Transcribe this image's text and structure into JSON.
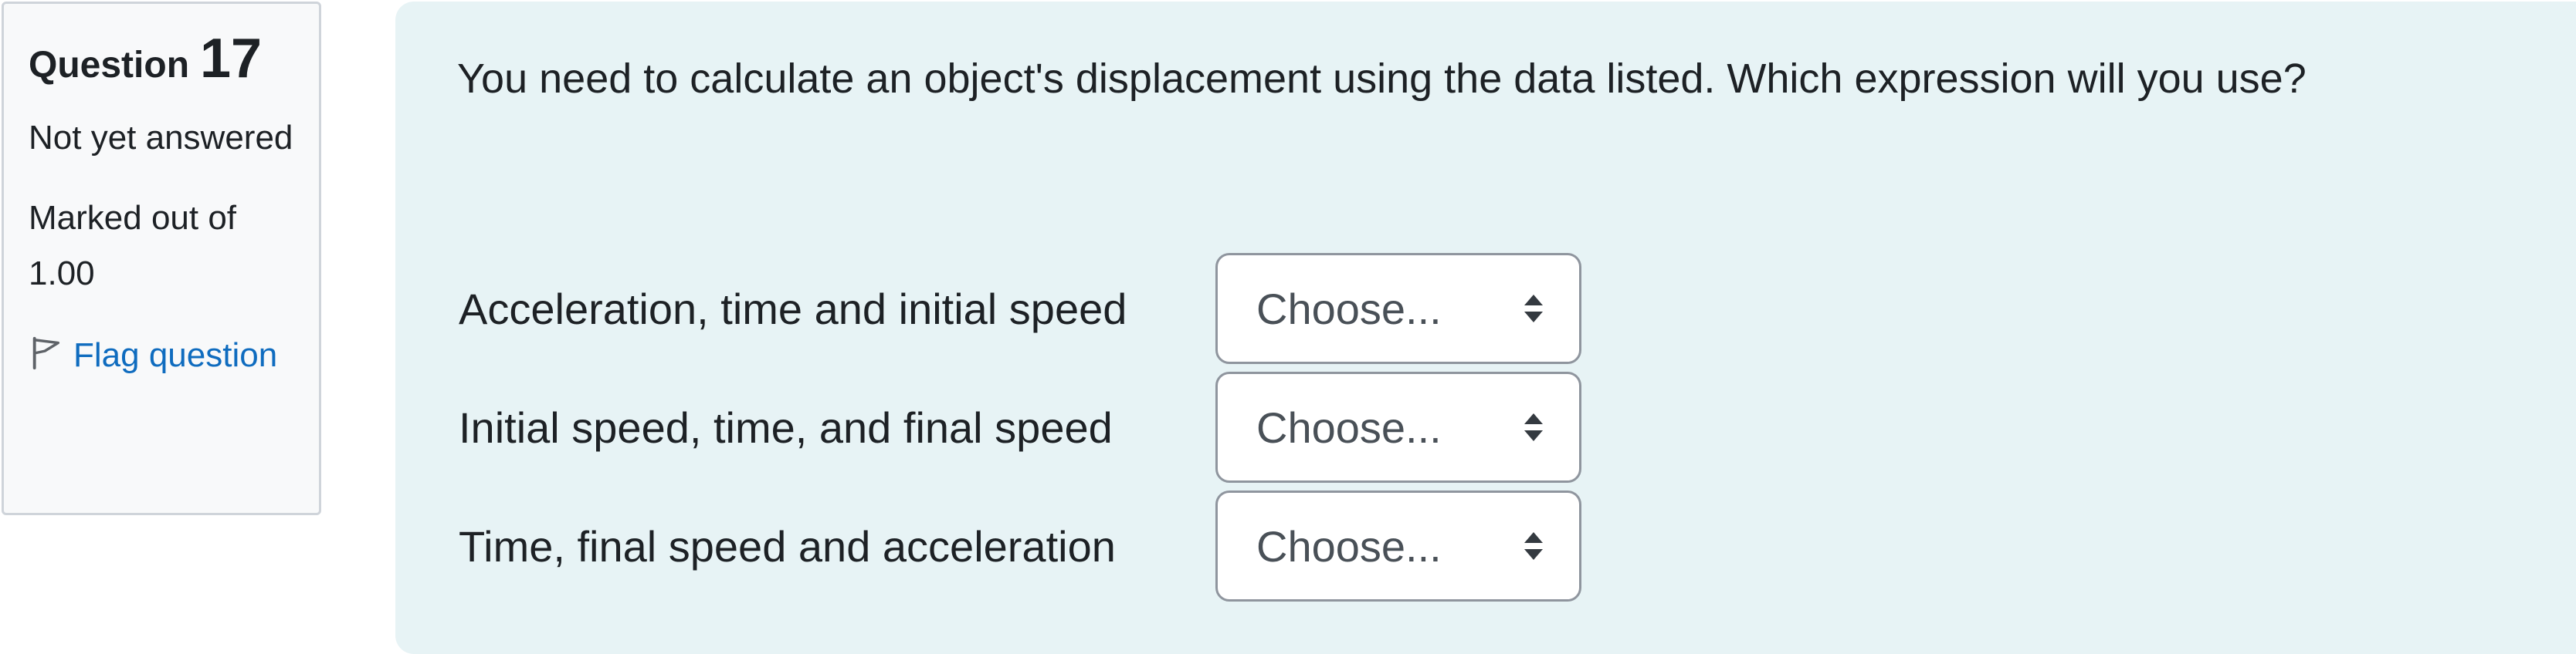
{
  "info": {
    "question_word": "Question",
    "question_number": "17",
    "state": "Not yet answered",
    "grade": "Marked out of 1.00",
    "flag_label": "Flag question"
  },
  "question": {
    "text": "You need to calculate an object's displacement using the data listed. Which expression will you use?",
    "rows": [
      {
        "label": "Acceleration, time and initial speed",
        "selected": "Choose..."
      },
      {
        "label": "Initial speed, time, and final speed",
        "selected": "Choose..."
      },
      {
        "label": "Time, final speed and acceleration",
        "selected": "Choose..."
      }
    ]
  },
  "colors": {
    "panel_bg": "#f8f9fa",
    "content_bg": "#e7f3f5",
    "link": "#0f6cbf",
    "border": "#8f959e"
  },
  "icons": {
    "flag": "flag-icon",
    "select": "up-down-arrows-icon"
  }
}
